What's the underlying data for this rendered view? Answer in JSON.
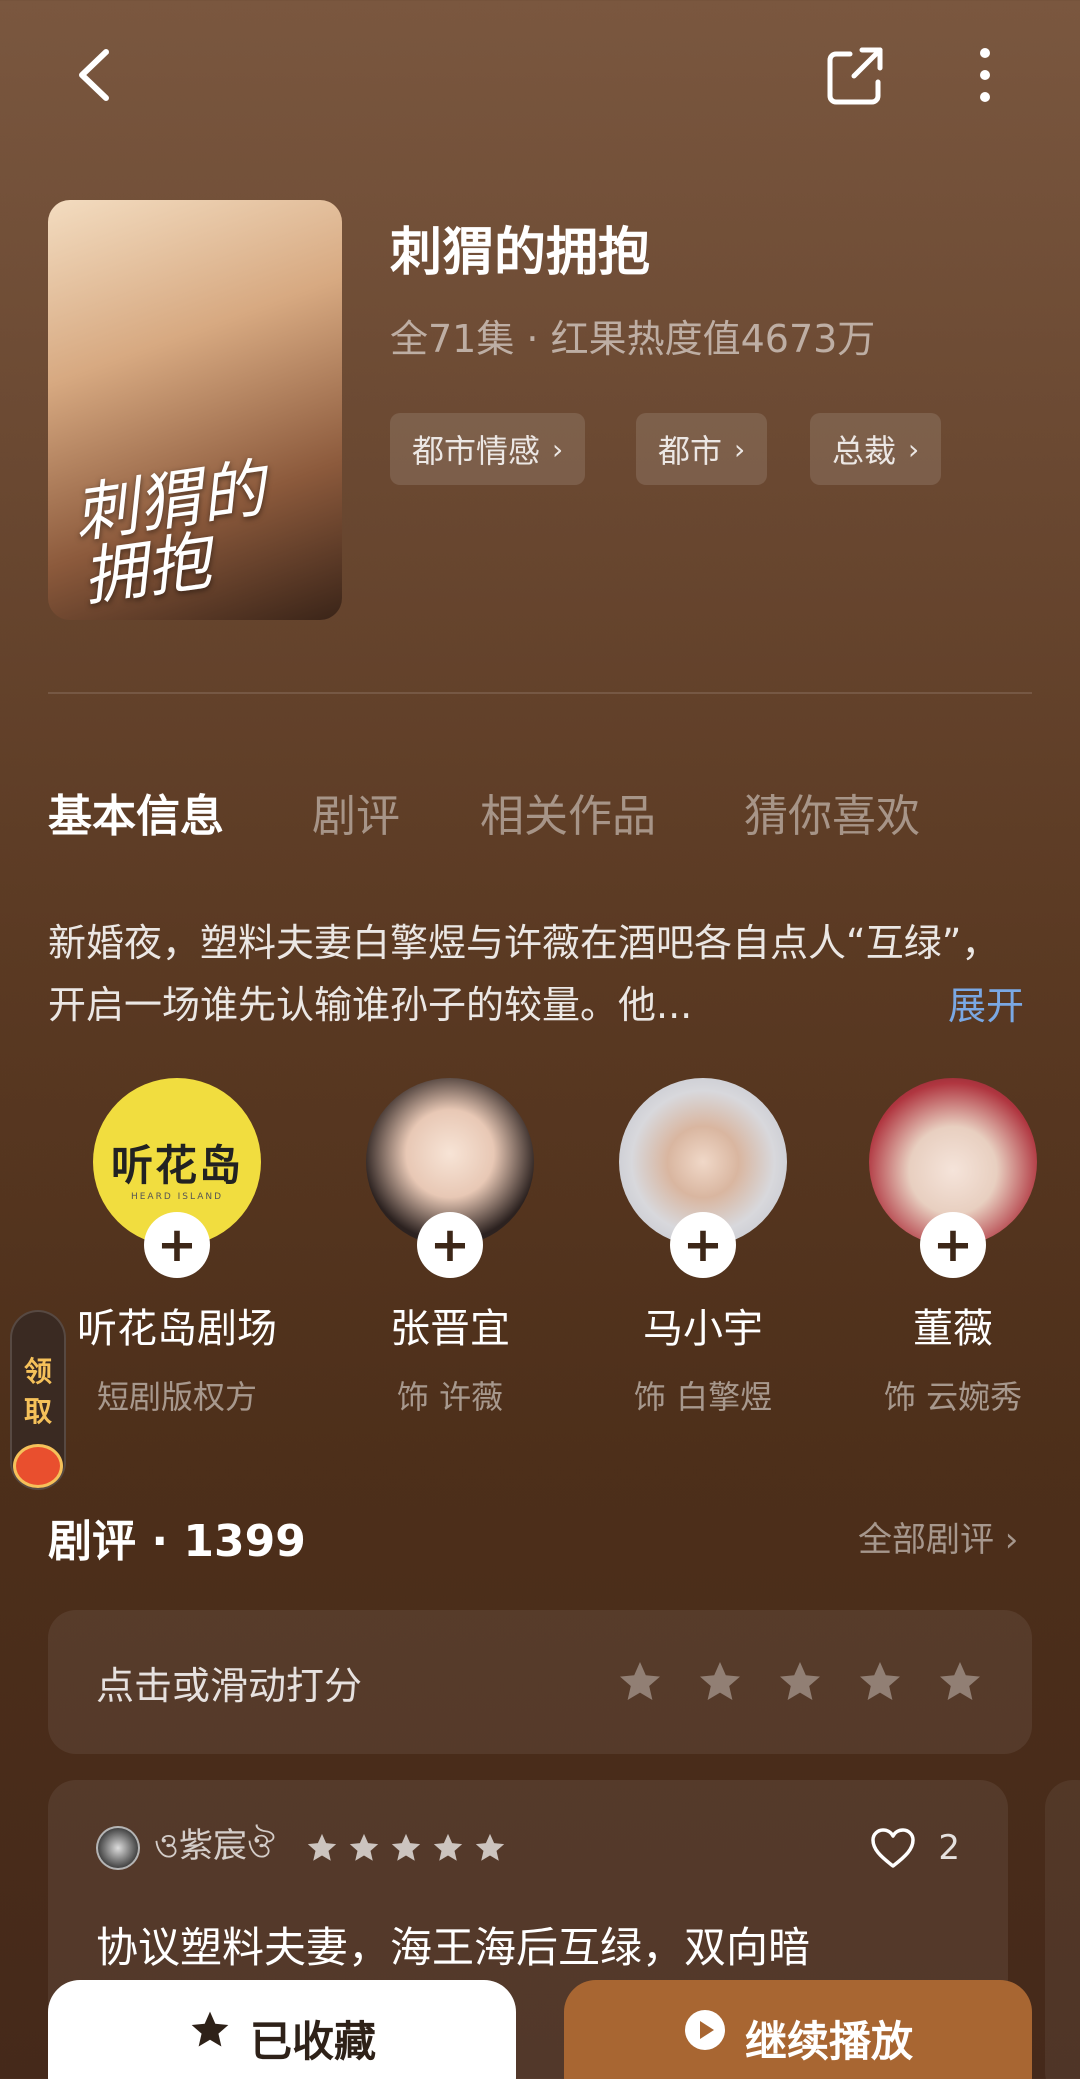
{
  "header": {
    "back_icon": "chevron-left-icon",
    "share_icon": "share-icon",
    "more_icon": "more-vertical-icon"
  },
  "drama": {
    "poster_title": "刺猬的\n拥抱",
    "title": "刺猬的拥抱",
    "meta": "全71集 · 红果热度值4673万",
    "tags": [
      "都市情感",
      "都市",
      "总裁"
    ]
  },
  "tabs": [
    "基本信息",
    "剧评",
    "相关作品",
    "猜你喜欢"
  ],
  "description": "新婚夜，塑料夫妻白擎煜与许薇在酒吧各自点人“互绿”，开启一场谁先认输谁孙子的较量。他...",
  "expand_label": "展开",
  "cast": [
    {
      "name": "听花岛剧场",
      "role": "短剧版权方",
      "logo_text": "听花岛",
      "logo_sub": "HEARD ISLAND"
    },
    {
      "name": "张晋宜",
      "role": "饰 许薇"
    },
    {
      "name": "马小宇",
      "role": "饰 白擎煜"
    },
    {
      "name": "董薇",
      "role": "饰 云婉秀"
    }
  ],
  "float_badge": {
    "line1": "领",
    "line2": "取"
  },
  "reviews": {
    "heading": "剧评 · 1399",
    "all_label": "全部剧评 ›",
    "rate_prompt": "点击或滑动打分",
    "rating_max": 5,
    "comment": {
      "user": "ও紫宸ঔ",
      "stars": 5,
      "likes": "2",
      "text": "协议塑料夫妻，海王海后互绿，双向暗"
    }
  },
  "bottom": {
    "fav_label": "已收藏",
    "play_label": "继续播放"
  },
  "colors": {
    "accent_blue": "#7aa8e4",
    "play_button": "#a86632",
    "logo_yellow": "#f1dd3f"
  }
}
